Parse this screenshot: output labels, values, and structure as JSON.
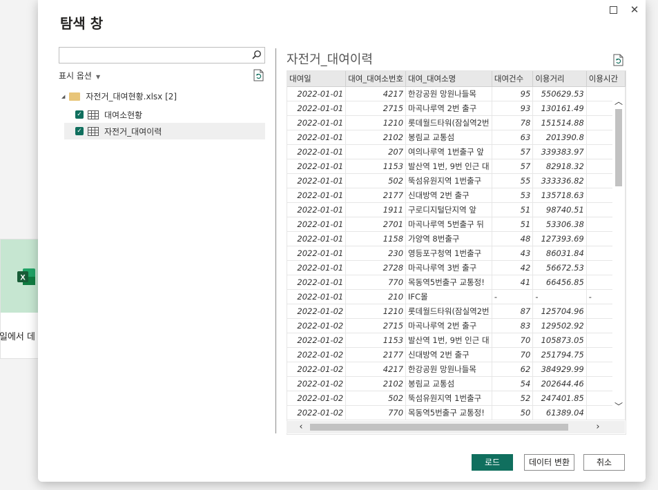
{
  "background": {
    "card_label": "일에서 데",
    "excel_icon": "excel-icon"
  },
  "dialog": {
    "title": "탐색 창",
    "maximize_icon": "maximize-icon",
    "close_icon": "close-icon"
  },
  "left": {
    "search_placeholder": "",
    "display_options": "표시 옵션",
    "file_name": "자전거_대여현황.xlsx [2]",
    "items": [
      {
        "label": "대여소현황",
        "checked": true,
        "selected": false
      },
      {
        "label": "자전거_대여이력",
        "checked": true,
        "selected": true
      }
    ]
  },
  "preview": {
    "title": "자전거_대여이력",
    "columns": [
      "대여일",
      "대여_대여소번호",
      "대여_대여소명",
      "대여건수",
      "이용거리",
      "이용시간"
    ],
    "rows": [
      [
        "2022-01-01",
        "4217",
        "한강공원 망원나들목",
        "95",
        "550629.53",
        ""
      ],
      [
        "2022-01-01",
        "2715",
        "마곡나루역 2번 출구",
        "93",
        "130161.49",
        ""
      ],
      [
        "2022-01-01",
        "1210",
        "롯데월드타워(잠실역2번",
        "78",
        "151514.88",
        ""
      ],
      [
        "2022-01-01",
        "2102",
        "봉림교 교통섬",
        "63",
        "201390.8",
        ""
      ],
      [
        "2022-01-01",
        "207",
        "여의나루역 1번출구 앞",
        "57",
        "339383.97",
        ""
      ],
      [
        "2022-01-01",
        "1153",
        "발산역 1번, 9번 인근 대",
        "57",
        "82918.32",
        ""
      ],
      [
        "2022-01-01",
        "502",
        "뚝섬유원지역 1번출구",
        "55",
        "333336.82",
        ""
      ],
      [
        "2022-01-01",
        "2177",
        "신대방역 2번 출구",
        "53",
        "135718.63",
        ""
      ],
      [
        "2022-01-01",
        "1911",
        "구로디지털단지역 앞",
        "51",
        "98740.51",
        ""
      ],
      [
        "2022-01-01",
        "2701",
        "마곡나루역 5번출구 뒤",
        "51",
        "53306.38",
        ""
      ],
      [
        "2022-01-01",
        "1158",
        "가양역 8번출구",
        "48",
        "127393.69",
        ""
      ],
      [
        "2022-01-01",
        "230",
        "영등포구청역 1번출구",
        "43",
        "86031.84",
        ""
      ],
      [
        "2022-01-01",
        "2728",
        "마곡나루역 3번 출구",
        "42",
        "56672.53",
        ""
      ],
      [
        "2022-01-01",
        "770",
        "목동역5번출구 교통정!",
        "41",
        "66456.85",
        ""
      ],
      [
        "2022-01-01",
        "210",
        "IFC몰",
        "-",
        "-",
        "-"
      ],
      [
        "2022-01-02",
        "1210",
        "롯데월드타워(잠실역2번",
        "87",
        "125704.96",
        ""
      ],
      [
        "2022-01-02",
        "2715",
        "마곡나루역 2번 출구",
        "83",
        "129502.92",
        ""
      ],
      [
        "2022-01-02",
        "1153",
        "발산역 1번, 9번 인근 대",
        "70",
        "105873.05",
        ""
      ],
      [
        "2022-01-02",
        "2177",
        "신대방역 2번 출구",
        "70",
        "251794.75",
        ""
      ],
      [
        "2022-01-02",
        "4217",
        "한강공원 망원나들목",
        "62",
        "384929.99",
        ""
      ],
      [
        "2022-01-02",
        "2102",
        "봉림교 교통섬",
        "54",
        "202644.46",
        ""
      ],
      [
        "2022-01-02",
        "502",
        "뚝섬유원지역 1번출구",
        "52",
        "247401.85",
        ""
      ],
      [
        "2022-01-02",
        "770",
        "목동역5번출구 교통정!",
        "50",
        "61389.04",
        ""
      ]
    ]
  },
  "buttons": {
    "load": "로드",
    "transform": "데이터 변환",
    "cancel": "취소"
  },
  "colors": {
    "accent": "#106f5e",
    "excel_green": "#1d6f42",
    "folder": "#e8c579"
  }
}
